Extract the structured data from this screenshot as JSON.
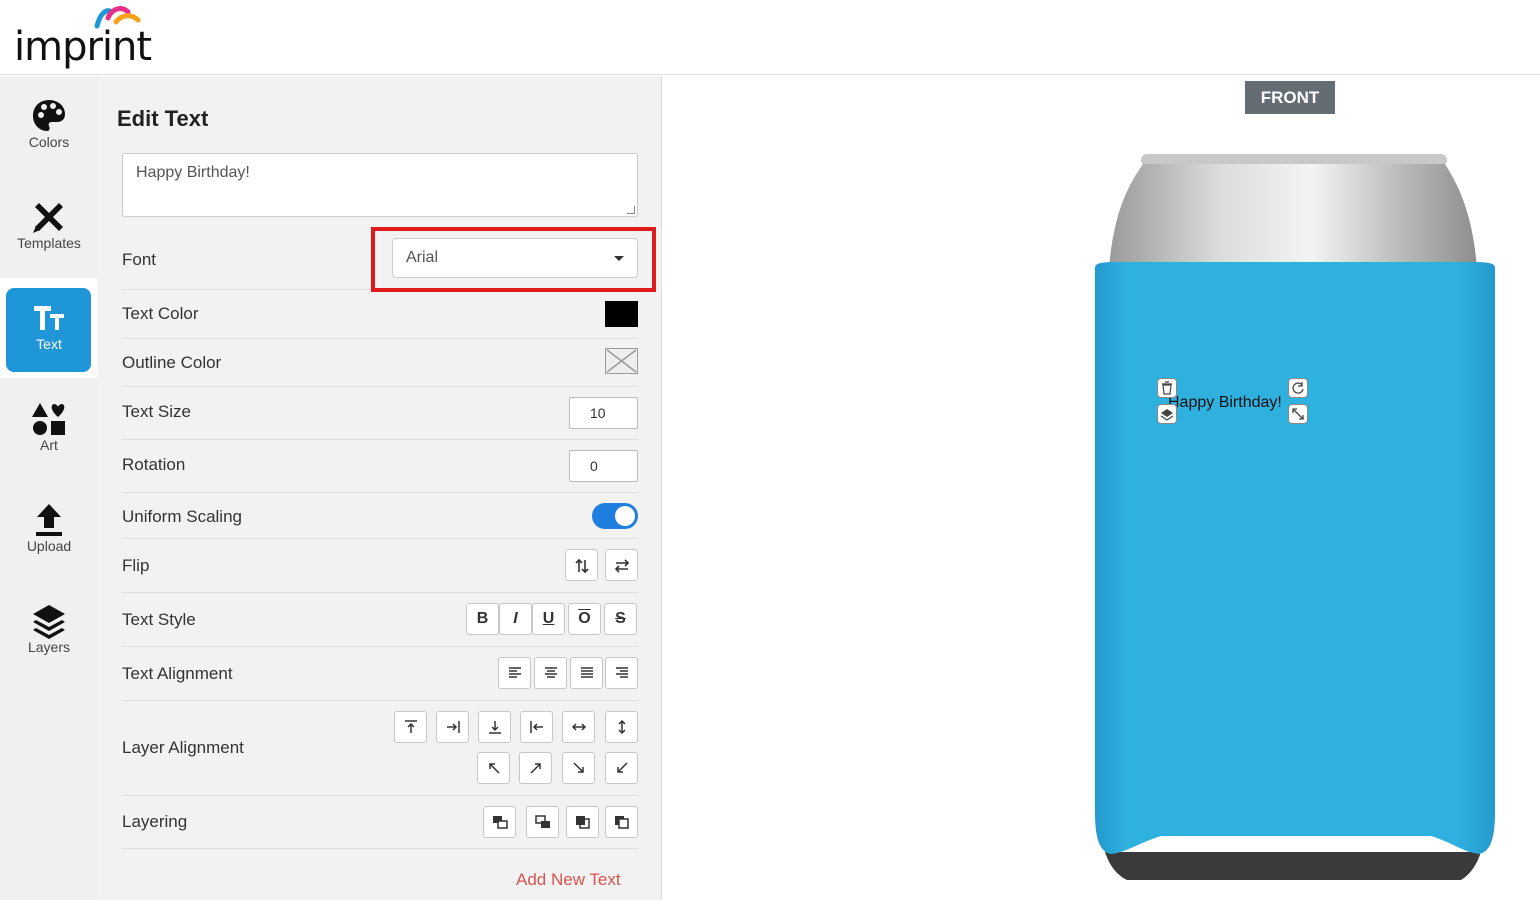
{
  "brand": {
    "logo_text": "imprint"
  },
  "nav": [
    {
      "label": "Colors",
      "icon": "palette-icon"
    },
    {
      "label": "Templates",
      "icon": "templates-icon"
    },
    {
      "label": "Text",
      "icon": "text-icon",
      "active": true
    },
    {
      "label": "Art",
      "icon": "shapes-icon"
    },
    {
      "label": "Upload",
      "icon": "upload-icon"
    },
    {
      "label": "Layers",
      "icon": "layers-icon"
    }
  ],
  "panel": {
    "title": "Edit Text",
    "text_value": "Happy Birthday!",
    "font_label": "Font",
    "font_value": "Arial",
    "text_color_label": "Text Color",
    "text_color": "#000000",
    "outline_color_label": "Outline Color",
    "text_size_label": "Text Size",
    "text_size": "10",
    "rotation_label": "Rotation",
    "rotation": "0",
    "uniform_scaling_label": "Uniform Scaling",
    "uniform_scaling_on": true,
    "flip_label": "Flip",
    "text_style_label": "Text Style",
    "text_style_buttons": [
      "B",
      "I",
      "U",
      "O",
      "S"
    ],
    "text_alignment_label": "Text Alignment",
    "layer_alignment_label": "Layer Alignment",
    "layering_label": "Layering",
    "add_new_text": "Add New Text"
  },
  "canvas": {
    "side_tab": "FRONT",
    "sleeve_color": "#2fb1e0",
    "text_on_item": "Happy Birthday!"
  }
}
